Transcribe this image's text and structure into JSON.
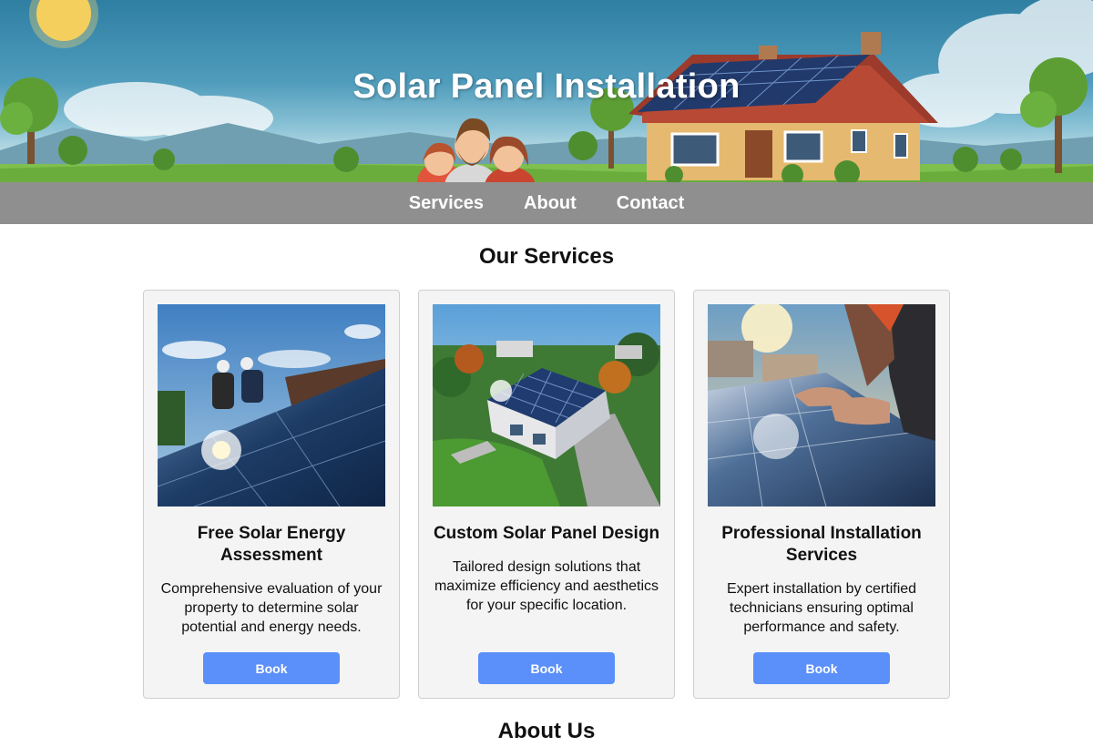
{
  "hero": {
    "title": "Solar Panel Installation"
  },
  "nav": {
    "items": [
      {
        "label": "Services"
      },
      {
        "label": "About"
      },
      {
        "label": "Contact"
      }
    ]
  },
  "services": {
    "heading": "Our Services",
    "cards": [
      {
        "title": "Free Solar Energy Assessment",
        "description": "Comprehensive evaluation of your property to determine solar potential and energy needs.",
        "button_label": "Book"
      },
      {
        "title": "Custom Solar Panel Design",
        "description": "Tailored design solutions that maximize efficiency and aesthetics for your specific location.",
        "button_label": "Book"
      },
      {
        "title": "Professional Installation Services",
        "description": "Expert installation by certified technicians ensuring optimal performance and safety.",
        "button_label": "Book"
      }
    ]
  },
  "about": {
    "heading": "About Us"
  },
  "colors": {
    "nav_background": "#8f8f8f",
    "button_background": "#5b8ff9",
    "card_background": "#f4f4f4"
  }
}
